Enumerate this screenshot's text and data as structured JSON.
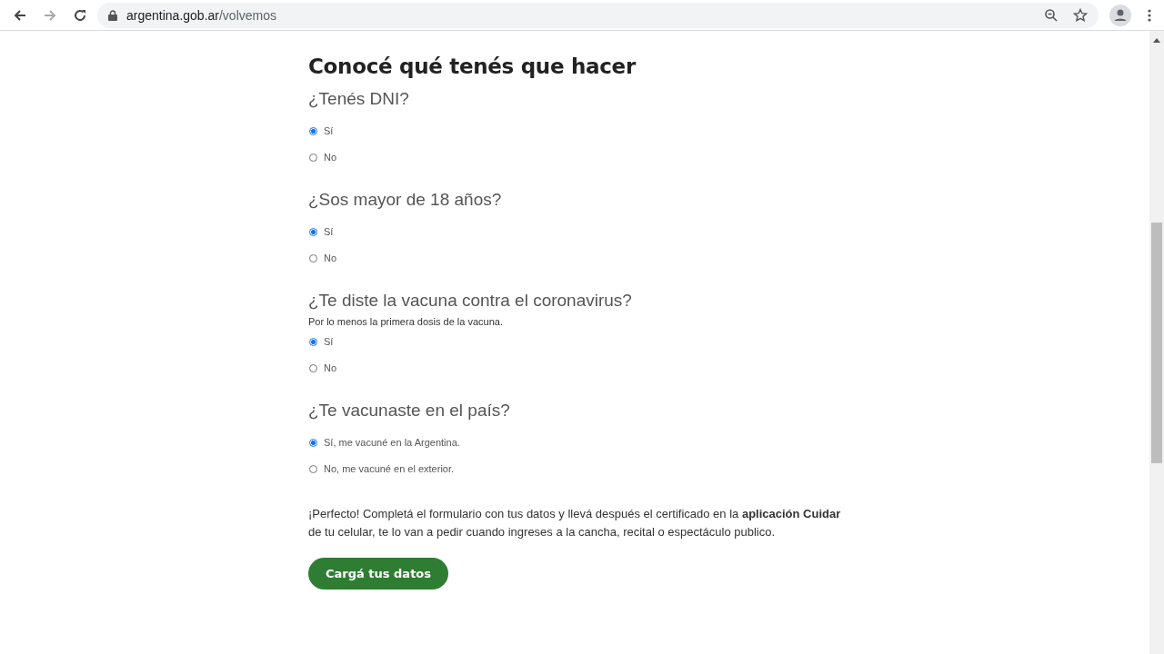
{
  "browser": {
    "url_host": "argentina.gob.ar",
    "url_path": "/volvemos"
  },
  "title": "Conocé qué tenés que hacer",
  "questions": [
    {
      "question": "¿Tenés DNI?",
      "options": [
        {
          "label": "Sí",
          "selected": true
        },
        {
          "label": "No",
          "selected": false
        }
      ]
    },
    {
      "question": "¿Sos mayor de 18 años?",
      "options": [
        {
          "label": "Sí",
          "selected": true
        },
        {
          "label": "No",
          "selected": false
        }
      ]
    },
    {
      "question": "¿Te diste la vacuna contra el coronavirus?",
      "hint": "Por lo menos la primera dosis de la vacuna.",
      "options": [
        {
          "label": "Sí",
          "selected": true
        },
        {
          "label": "No",
          "selected": false
        }
      ]
    },
    {
      "question": "¿Te vacunaste en el país?",
      "options": [
        {
          "label": "Sí, me vacuné en la Argentina.",
          "selected": true
        },
        {
          "label": "No, me vacuné en el exterior.",
          "selected": false
        }
      ]
    }
  ],
  "message": "¡Perfecto! Completá el formulario con tus datos y llevá después el certificado en la **aplicación Cuidar** de tu celular, te lo van a pedir cuando ingreses a la cancha, recital o espectáculo publico.",
  "button": "Cargá tus datos"
}
